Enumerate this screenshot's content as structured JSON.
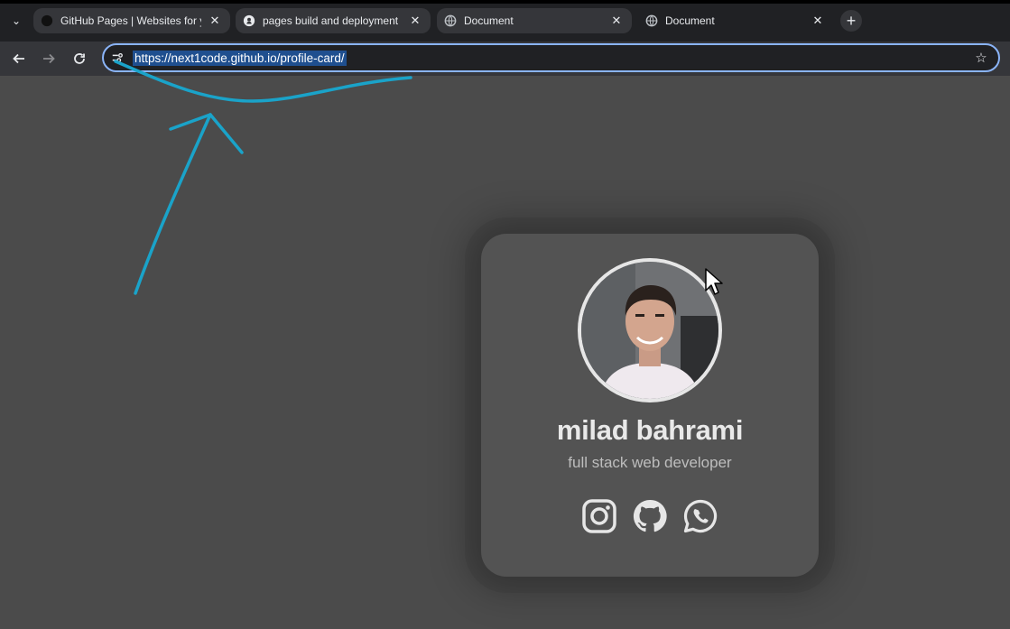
{
  "browser": {
    "tabs": [
      {
        "title": "GitHub Pages | Websites for you",
        "favicon": "github-icon"
      },
      {
        "title": "pages build and deployment · n",
        "favicon": "github-icon"
      },
      {
        "title": "Document",
        "favicon": "globe-icon"
      },
      {
        "title": "Document",
        "favicon": "globe-icon"
      }
    ],
    "new_tab_label": "+",
    "address": "https://next1code.github.io/profile-card/",
    "accent": "#8ab4f8"
  },
  "profile": {
    "name": "milad bahrami",
    "role": "full stack web developer",
    "socials": [
      {
        "icon": "instagram-icon"
      },
      {
        "icon": "github-icon"
      },
      {
        "icon": "whatsapp-icon"
      }
    ]
  },
  "annotation_color": "#1aa3c9"
}
